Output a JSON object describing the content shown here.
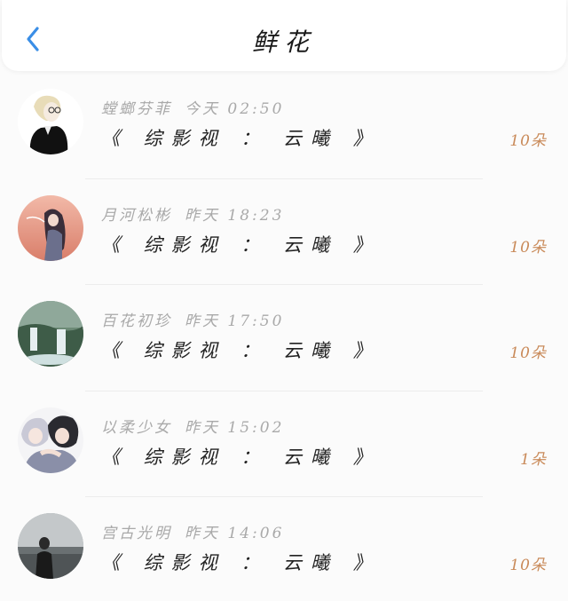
{
  "header": {
    "title": "鲜花"
  },
  "items": [
    {
      "name": "螳螂芬菲",
      "time": "今天 02:50",
      "book": "《 综影视 ： 云曦 》",
      "count": "10朵",
      "avatar": "avatar-sketch-boy"
    },
    {
      "name": "月河松彬",
      "time": "昨天 18:23",
      "book": "《 综影视 ： 云曦 》",
      "count": "10朵",
      "avatar": "avatar-sunset-girl"
    },
    {
      "name": "百花初珍",
      "time": "昨天 17:50",
      "book": "《 综影视 ： 云曦 》",
      "count": "10朵",
      "avatar": "avatar-waterfall"
    },
    {
      "name": "以柔少女",
      "time": "昨天 15:02",
      "book": "《 综影视 ： 云曦 》",
      "count": "1朵",
      "avatar": "avatar-anime-duo"
    },
    {
      "name": "宫古光明",
      "time": "昨天 14:06",
      "book": "《 综影视 ： 云曦 》",
      "count": "10朵",
      "avatar": "avatar-person-landscape"
    }
  ],
  "colors": {
    "accent": "#3a8ee6",
    "count": "#c98a59",
    "meta": "#a9a9a9"
  }
}
